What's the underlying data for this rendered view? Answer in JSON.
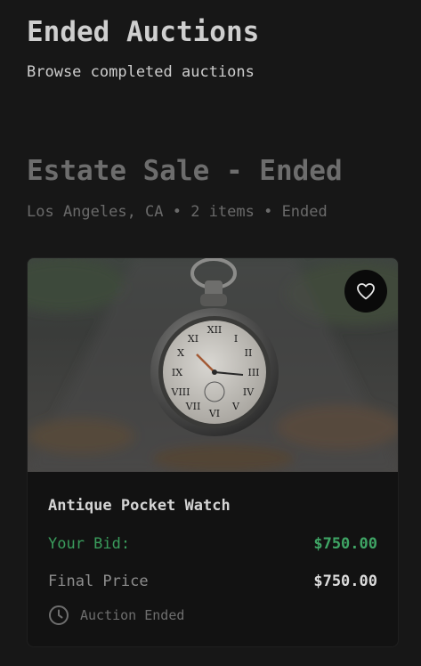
{
  "header": {
    "title": "Ended Auctions",
    "subtitle": "Browse completed auctions"
  },
  "sale": {
    "title": "Estate Sale - Ended",
    "meta": "Los Angeles, CA • 2 items • Ended"
  },
  "card": {
    "image_icon": "pocket-watch-photo",
    "favorite_icon": "heart-outline-icon",
    "item_name": "Antique Pocket Watch",
    "your_bid_label": "Your Bid:",
    "your_bid_value": "$750.00",
    "final_price_label": "Final Price",
    "final_price_value": "$750.00",
    "status_icon": "clock-icon",
    "status_text": "Auction Ended"
  },
  "colors": {
    "background": "#171717",
    "card_background": "#121212",
    "bid_green": "#3fa565"
  }
}
